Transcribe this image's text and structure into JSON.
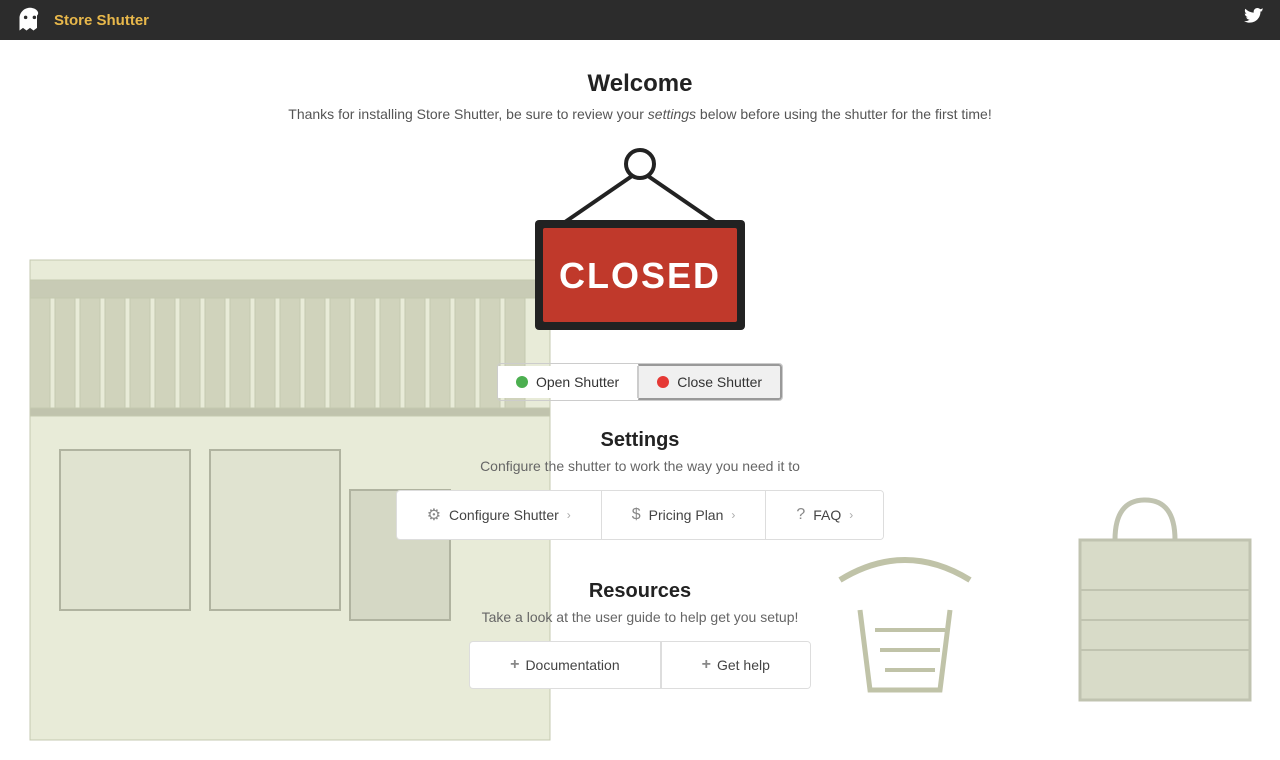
{
  "header": {
    "app_title": "Store Shutter",
    "logo_icon": "ghost-icon",
    "twitter_icon": "twitter-icon"
  },
  "welcome": {
    "title": "Welcome",
    "subtitle_prefix": "Thanks for installing Store Shutter, be sure to review your ",
    "subtitle_link": "settings",
    "subtitle_suffix": " below before using the shutter for the first time!"
  },
  "closed_sign": {
    "text": "CLOSED"
  },
  "shutter_toggle": {
    "open_label": "Open Shutter",
    "close_label": "Close Shutter"
  },
  "settings": {
    "title": "Settings",
    "subtitle": "Configure the shutter to work the way you need it to",
    "buttons": [
      {
        "id": "configure",
        "icon": "gear",
        "label": "Configure Shutter",
        "chevron": "›"
      },
      {
        "id": "pricing",
        "icon": "dollar",
        "label": "Pricing Plan",
        "chevron": "›"
      },
      {
        "id": "faq",
        "icon": "question",
        "label": "FAQ",
        "chevron": "›"
      }
    ]
  },
  "resources": {
    "title": "Resources",
    "subtitle": "Take a look at the user guide to help get you setup!",
    "buttons": [
      {
        "id": "docs",
        "label": "Documentation"
      },
      {
        "id": "help",
        "label": "Get help"
      }
    ]
  }
}
